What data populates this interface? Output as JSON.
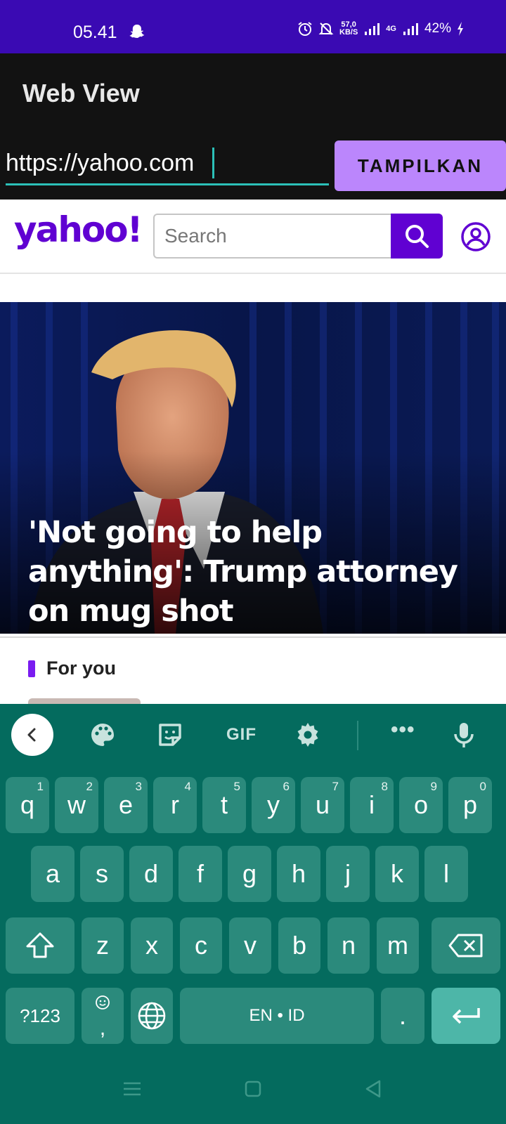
{
  "status_bar": {
    "time": "05.41",
    "net_speed_value": "57,0",
    "net_speed_unit": "KB/S",
    "network_type": "4G",
    "battery": "42%"
  },
  "app": {
    "title": "Web View",
    "url_value": "https://yahoo.com",
    "show_button_label": "TAMPILKAN"
  },
  "webpage": {
    "logo": "yahoo!",
    "search_placeholder": "Search",
    "hero_headline": "'Not going to help anything': Trump attorney on mug shot",
    "section_title": "For you"
  },
  "keyboard": {
    "toolbar": {
      "gif_label": "GIF",
      "more_label": "•••"
    },
    "row1": [
      {
        "key": "q",
        "hint": "1"
      },
      {
        "key": "w",
        "hint": "2"
      },
      {
        "key": "e",
        "hint": "3"
      },
      {
        "key": "r",
        "hint": "4"
      },
      {
        "key": "t",
        "hint": "5"
      },
      {
        "key": "y",
        "hint": "6"
      },
      {
        "key": "u",
        "hint": "7"
      },
      {
        "key": "i",
        "hint": "8"
      },
      {
        "key": "o",
        "hint": "9"
      },
      {
        "key": "p",
        "hint": "0"
      }
    ],
    "row2": [
      "a",
      "s",
      "d",
      "f",
      "g",
      "h",
      "j",
      "k",
      "l"
    ],
    "row3": [
      "z",
      "x",
      "c",
      "v",
      "b",
      "n",
      "m"
    ],
    "symbols_label": "?123",
    "comma_label": ",",
    "space_label": "EN • ID",
    "period_label": "."
  },
  "colors": {
    "status_bar": "#3a0ab3",
    "app_bar": "#121212",
    "accent_teal": "#2cc0b8",
    "button_purple": "#bb86fc",
    "yahoo_purple": "#6001d2",
    "keyboard_bg": "#046b5e",
    "key_bg": "#2b8a7c"
  }
}
